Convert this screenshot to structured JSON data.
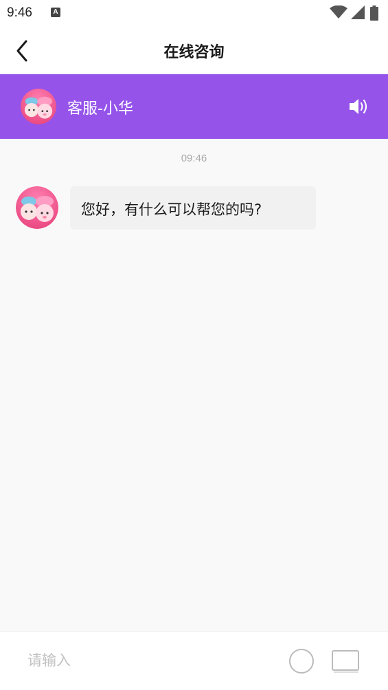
{
  "status_bar": {
    "time": "9:46",
    "notification_badge": "A",
    "icons": [
      "wifi-icon",
      "signal-icon",
      "battery-icon"
    ]
  },
  "nav": {
    "title": "在线咨询",
    "back_icon": "chevron-left-icon"
  },
  "agent": {
    "name": "客服-小华",
    "avatar": "cartoon-avatar",
    "speaker_icon": "speaker-icon"
  },
  "chat": {
    "messages": [
      {
        "time": "09:46",
        "sender": "agent",
        "text": "您好，有什么可以帮您的吗?"
      }
    ]
  },
  "input": {
    "placeholder": "请输入",
    "value": ""
  },
  "colors": {
    "accent": "#9553EA",
    "chat_background": "#f9f9f9",
    "bubble": "#f1f1f1"
  }
}
